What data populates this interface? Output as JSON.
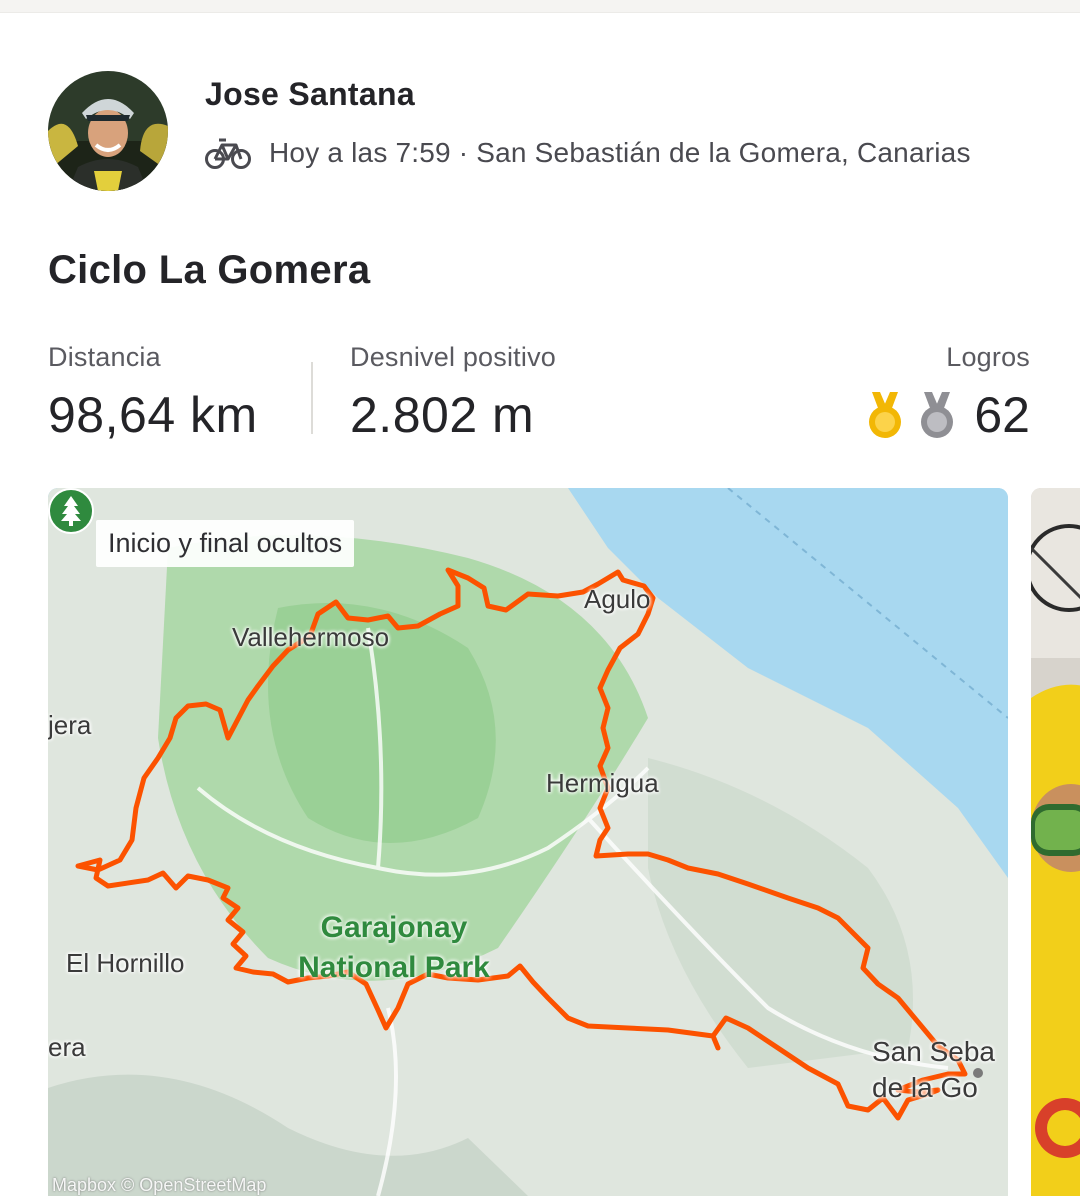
{
  "athlete": {
    "name": "Jose Santana",
    "activity_icon": "bicycle-icon",
    "meta": "Hoy a las 7:59 · San Sebastián de la Gomera, Canarias"
  },
  "activity": {
    "title": "Ciclo La Gomera"
  },
  "stats": {
    "distance_label": "Distancia",
    "distance_value": "98,64 km",
    "elevation_label": "Desnivel positivo",
    "elevation_value": "2.802 m",
    "achievements_label": "Logros",
    "achievements_icons": [
      "gold-medal-icon",
      "silver-medal-icon"
    ],
    "achievements_value": "62"
  },
  "map": {
    "privacy_badge": "Inicio y final ocultos",
    "places": {
      "vallehermoso": "Vallehermoso",
      "agulo": "Agulo",
      "hermigua": "Hermigua",
      "alojera_partial": "jera",
      "el_hornillo": "El Hornillo",
      "era_partial": "era",
      "san_sebastian_line1": "San Seba",
      "san_sebastian_line2": "de la Go"
    },
    "park_label_line1": "Garajonay",
    "park_label_line2": "National Park",
    "attribution": "Mapbox © OpenStreetMap",
    "colors": {
      "route": "#fc5200",
      "water": "#a8d8f0",
      "land": "#dde8dc",
      "park": "#9fd49a"
    }
  }
}
